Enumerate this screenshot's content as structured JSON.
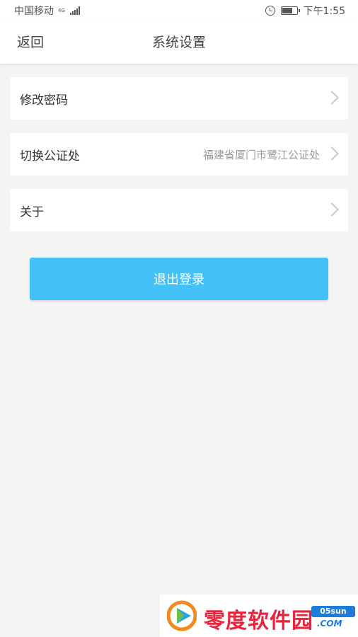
{
  "status_bar": {
    "carrier": "中国移动",
    "network": "4G",
    "time": "下午1:55",
    "battery_level": 0.75
  },
  "header": {
    "back_label": "返回",
    "title": "系统设置"
  },
  "settings": {
    "items": [
      {
        "label": "修改密码",
        "value": ""
      },
      {
        "label": "切换公证处",
        "value": "福建省厦门市鹭江公证处"
      },
      {
        "label": "关于",
        "value": ""
      }
    ]
  },
  "logout_label": "退出登录",
  "watermark": {
    "text": "零度软件园",
    "badge": "05sun",
    "domain": ".COM"
  },
  "colors": {
    "accent": "#44c2f7",
    "background": "#f4f4f4"
  }
}
